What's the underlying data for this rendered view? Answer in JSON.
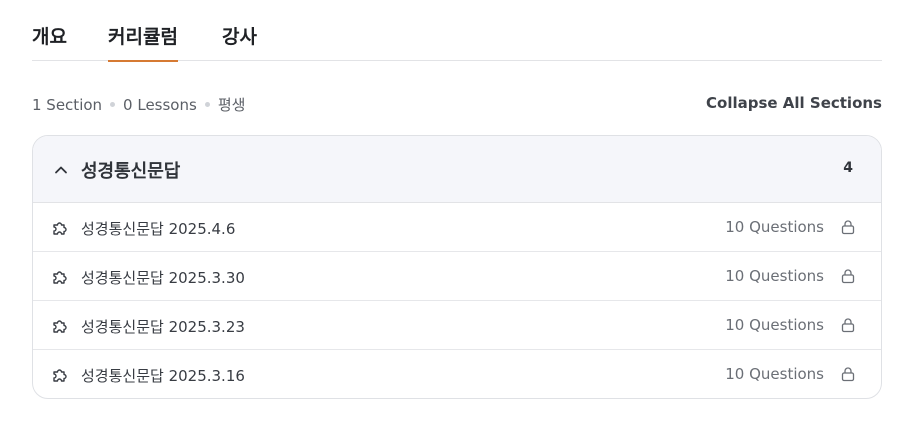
{
  "tabs": [
    {
      "label": "개요"
    },
    {
      "label": "커리큘럼"
    },
    {
      "label": "강사"
    }
  ],
  "meta": {
    "sections": "1 Section",
    "lessons": "0 Lessons",
    "duration": "평생"
  },
  "collapse_label": "Collapse All Sections",
  "section": {
    "title": "성경통신문답",
    "count": "4",
    "items": [
      {
        "title": "성경통신문답 2025.4.6",
        "questions": "10 Questions"
      },
      {
        "title": "성경통신문답 2025.3.30",
        "questions": "10 Questions"
      },
      {
        "title": "성경통신문답 2025.3.23",
        "questions": "10 Questions"
      },
      {
        "title": "성경통신문답 2025.3.16",
        "questions": "10 Questions"
      }
    ]
  },
  "colors": {
    "accent": "#d67a33",
    "header_bg": "#f5f6fa"
  },
  "icons": {
    "section_toggle": "chevron-up-icon",
    "item": "puzzle-icon",
    "item_status": "lock-icon"
  }
}
